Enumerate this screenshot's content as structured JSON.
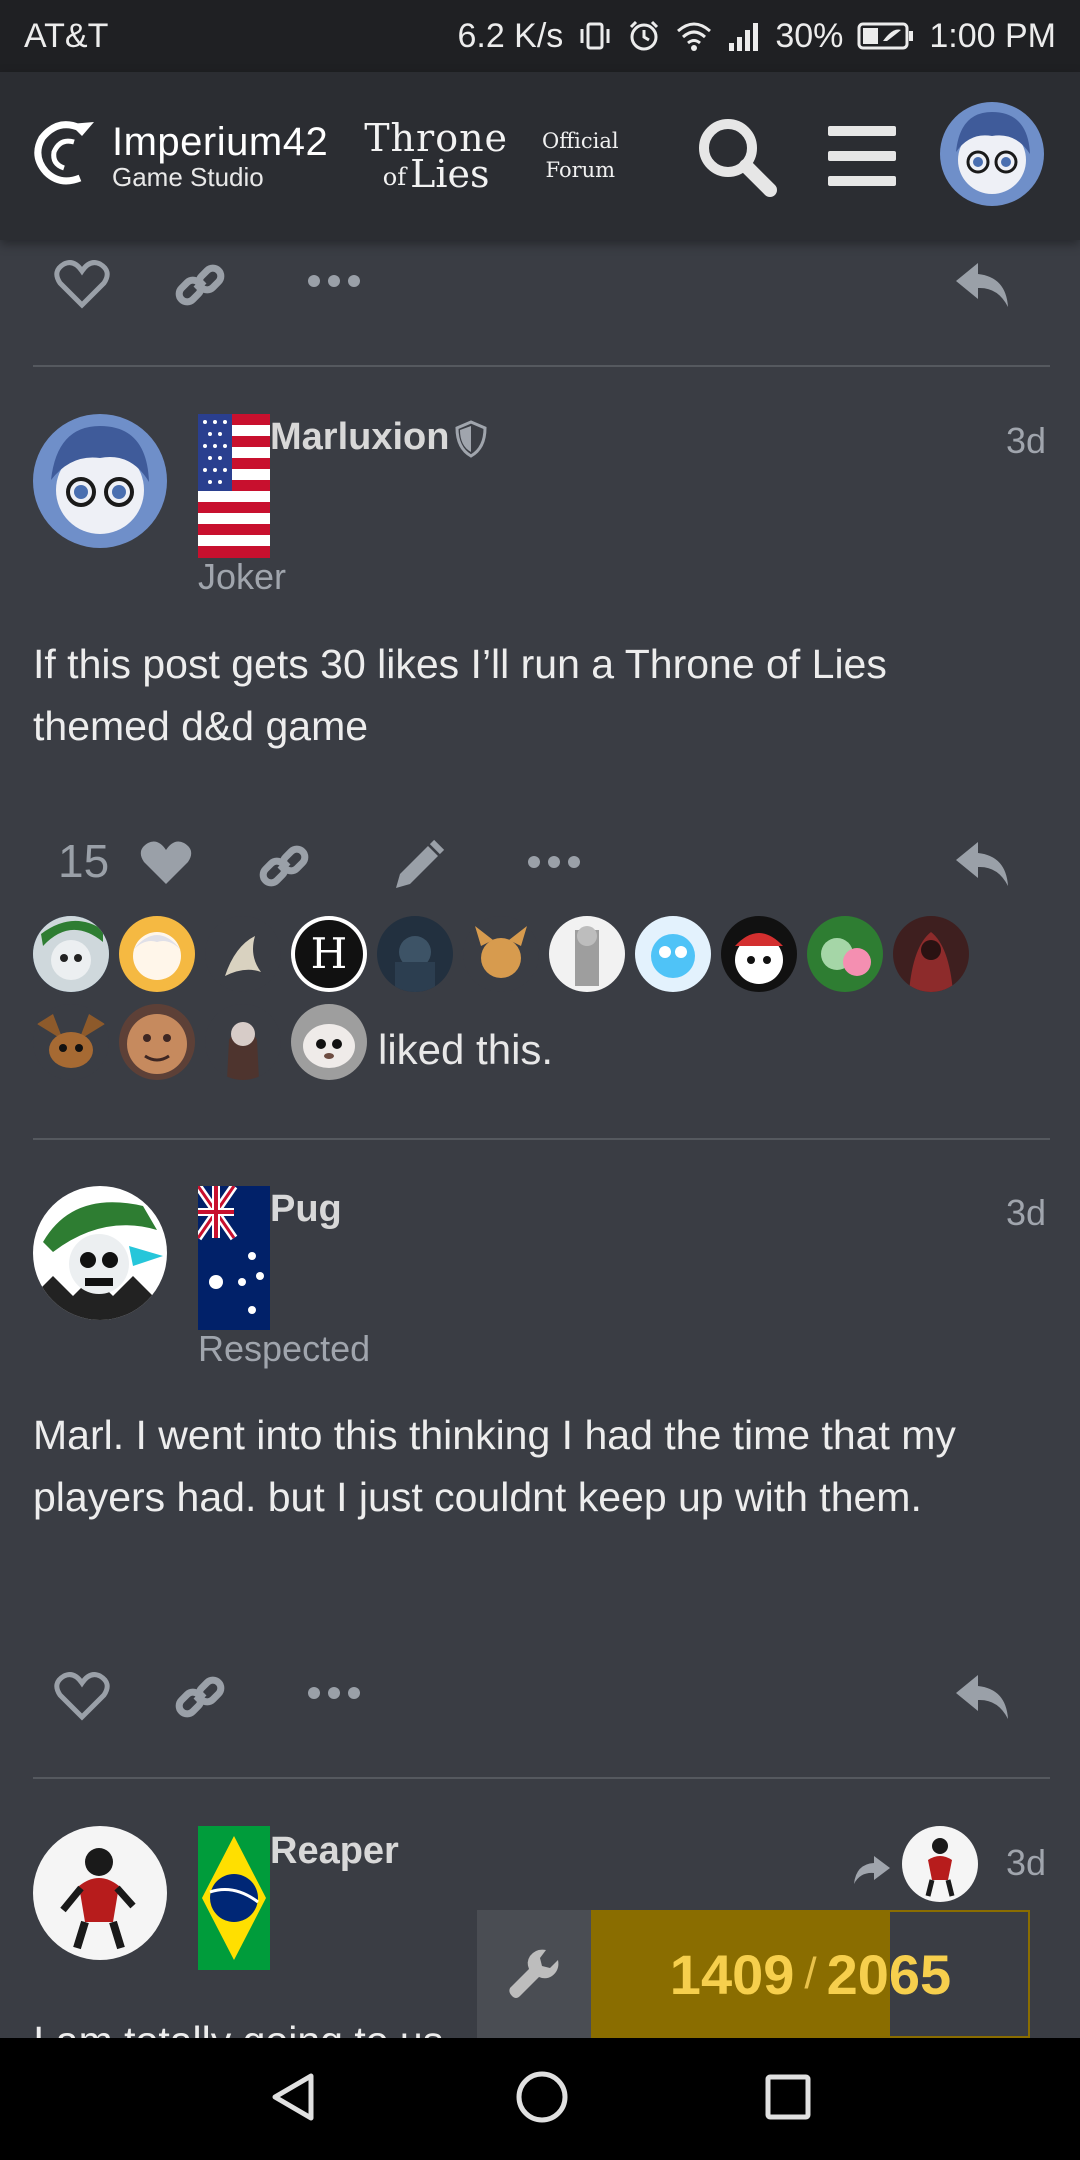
{
  "status_bar": {
    "carrier": "AT&T",
    "speed": "6.2 K/s",
    "battery": "30%",
    "time": "1:00 PM",
    "icons": [
      "vibrate-icon",
      "alarm-icon",
      "wifi-icon",
      "signal-icon",
      "battery-icon"
    ]
  },
  "header": {
    "brand_name": "Imperium42",
    "brand_sub": "Game Studio",
    "game_title_line1": "Throne",
    "game_title_of": "of",
    "game_title_line2": "Lies",
    "forum_line1": "Official",
    "forum_line2": "Forum",
    "icons": [
      "search-icon",
      "menu-icon",
      "user-avatar"
    ]
  },
  "posts": [
    {
      "username": "Marluxion",
      "user_title": "Joker",
      "date": "3d",
      "flag": "USA",
      "body": "If this post gets 30 likes I’ll run a Throne of Lies themed d&d game",
      "like_count": "15",
      "liked_suffix": "liked this."
    },
    {
      "username": "Pug",
      "user_title": "Respected",
      "date": "3d",
      "flag": "Australia",
      "body": "Marl. I went into this thinking I had the time that my players had. but I just couldnt keep up with them."
    },
    {
      "username": "Reaper",
      "date": "3d",
      "flag": "Brazil",
      "body": "I am totally going to us"
    }
  ],
  "progress": {
    "current": "1409",
    "separator": "/",
    "total": "2065",
    "fraction": 0.682,
    "accent": "#8a6d00",
    "text_color": "#f6cf4d"
  },
  "colors": {
    "background": "#3a3d44",
    "header": "#2b2d32",
    "icon_muted": "#9aa0a8"
  }
}
